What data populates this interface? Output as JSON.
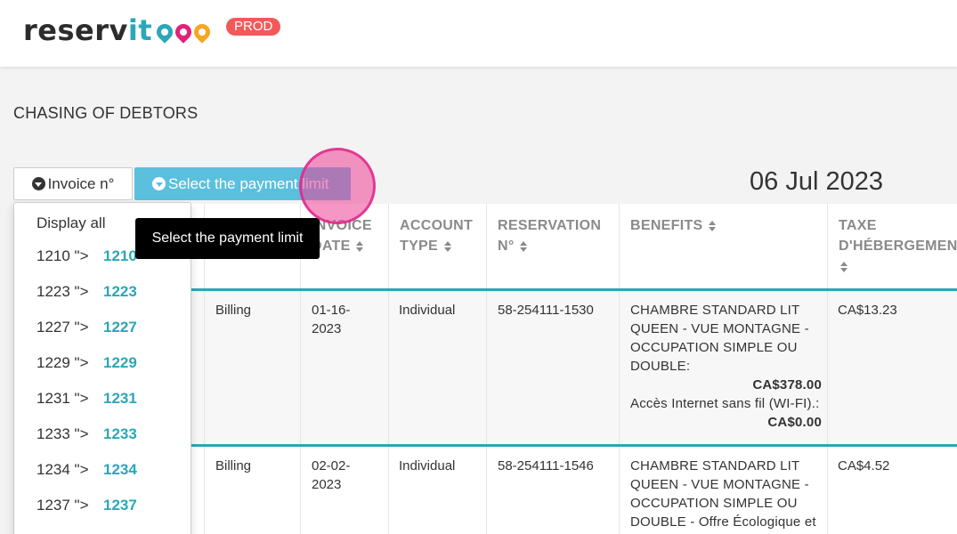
{
  "header": {
    "logo_text_main": "reserv",
    "logo_text_accent": "it",
    "env_badge": "PROD",
    "pin_colors": [
      "#2aa7b8",
      "#e0217a",
      "#f5a623"
    ]
  },
  "page": {
    "title": "CHASING OF DEBTORS",
    "date": "06 Jul 2023"
  },
  "toolbar": {
    "invoice_filter_label": "Invoice n°",
    "payment_limit_label": "Select the payment limit"
  },
  "tooltip": {
    "text": "Select the payment limit"
  },
  "invoice_dropdown": {
    "display_all": "Display all",
    "items": [
      {
        "raw": "1210 \">",
        "num": "1210"
      },
      {
        "raw": "1223 \">",
        "num": "1223"
      },
      {
        "raw": "1227 \">",
        "num": "1227"
      },
      {
        "raw": "1229 \">",
        "num": "1229"
      },
      {
        "raw": "1231 \">",
        "num": "1231"
      },
      {
        "raw": "1233 \">",
        "num": "1233"
      },
      {
        "raw": "1234 \">",
        "num": "1234"
      },
      {
        "raw": "1237 \">",
        "num": "1237"
      }
    ]
  },
  "table": {
    "headers": {
      "invoice_date_1": "INVOICE",
      "invoice_date_2": "DATE",
      "account_type_1": "ACCOUNT",
      "account_type_2": "TYPE",
      "reservation_1": "RESERVATION",
      "reservation_2": "N°",
      "benefits": "BENEFITS",
      "tax_1": "TAXE",
      "tax_2": "D'HÉBERGEMENT"
    },
    "rows": [
      {
        "kind": "Billing",
        "date_1": "01-16-",
        "date_2": "2023",
        "account_type": "Individual",
        "reservation": "58-254111-1530",
        "benefit_desc_1": "CHAMBRE STANDARD LIT QUEEN - VUE MONTAGNE - OCCUPATION SIMPLE OU DOUBLE:",
        "benefit_amt_1": "CA$378.00",
        "benefit_desc_2": "Accès Internet sans fil (WI-FI).:",
        "benefit_amt_2": "CA$0.00",
        "tax": "CA$13.23"
      },
      {
        "kind": "Billing",
        "date_1": "02-02-",
        "date_2": "2023",
        "account_type": "Individual",
        "reservation": "58-254111-1546",
        "benefit_desc_1": "CHAMBRE STANDARD LIT QUEEN - VUE MONTAGNE - OCCUPATION SIMPLE OU DOUBLE - Offre Écologique et",
        "tax": "CA$4.52"
      }
    ]
  }
}
